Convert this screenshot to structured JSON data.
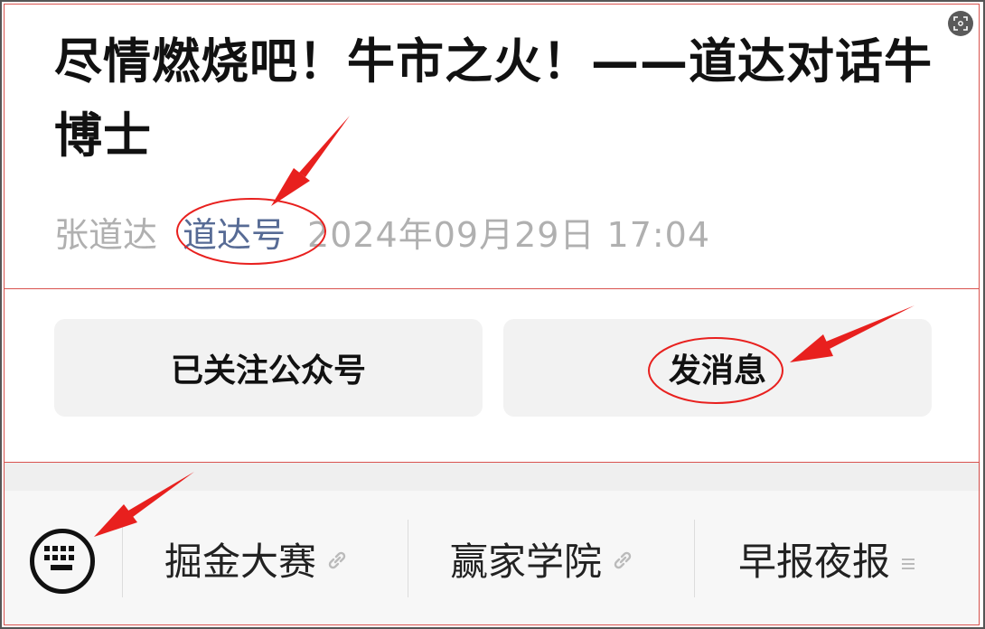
{
  "article": {
    "title": "尽情燃烧吧！牛市之火！——道达对话牛博士",
    "author": "张道达",
    "account_name": "道达号",
    "datetime": "2024年09月29日 17:04"
  },
  "actions": {
    "follow_label": "已关注公众号",
    "message_label": "发消息"
  },
  "menu": {
    "items": [
      {
        "label": "掘金大赛",
        "icon": "link-icon"
      },
      {
        "label": "赢家学院",
        "icon": "link-icon"
      },
      {
        "label": "早报夜报",
        "icon": "list-icon"
      }
    ]
  },
  "icons": {
    "corner": "scan-icon",
    "keyboard": "keyboard-icon"
  },
  "colors": {
    "account_link": "#576b95",
    "annotation_red": "#e8201e",
    "muted_text": "#b0b0b0",
    "button_bg": "#f2f2f2"
  }
}
